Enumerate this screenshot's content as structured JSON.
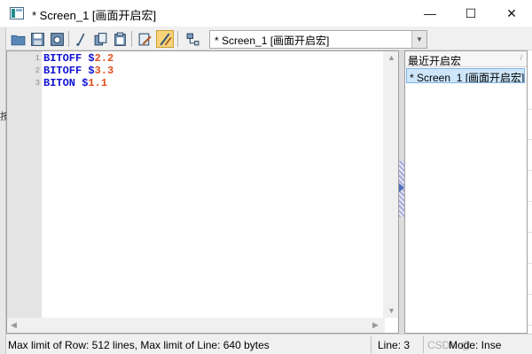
{
  "window": {
    "title": "* Screen_1 [画面开启宏]",
    "minimize_glyph": "—",
    "maximize_glyph": "☐",
    "close_glyph": "✕"
  },
  "background_app": {
    "partial_text": "按"
  },
  "toolbar": {
    "buttons": [
      {
        "icon": "open-folder-icon"
      },
      {
        "icon": "save-icon"
      },
      {
        "icon": "save-all-icon"
      },
      {
        "icon": "cut-icon"
      },
      {
        "icon": "copy-icon"
      },
      {
        "icon": "paste-icon"
      },
      {
        "icon": "compile-icon"
      },
      {
        "icon": "edit-script-icon",
        "active": true
      },
      {
        "icon": "settings-icon"
      }
    ],
    "macro_select": {
      "value": "* Screen_1 [画面开启宏]"
    }
  },
  "editor": {
    "lines": [
      {
        "num": "1",
        "keyword": "BITOFF $",
        "value": "2.2"
      },
      {
        "num": "2",
        "keyword": "BITOFF $",
        "value": "3.3"
      },
      {
        "num": "3",
        "keyword": "BITON $",
        "value": "1.1"
      }
    ],
    "colors": {
      "keyword": "#1212d4",
      "value": "#e0501e"
    }
  },
  "recent_panel": {
    "header": "最近开启宏",
    "items": [
      "* Screen_1 [画面开启宏]"
    ]
  },
  "status": {
    "main": "Max limit of Row: 512 lines, Max limit of Line: 640 bytes",
    "line": "Line: 3",
    "mode": "Mode: Inse",
    "watermark": "CSDN @"
  }
}
